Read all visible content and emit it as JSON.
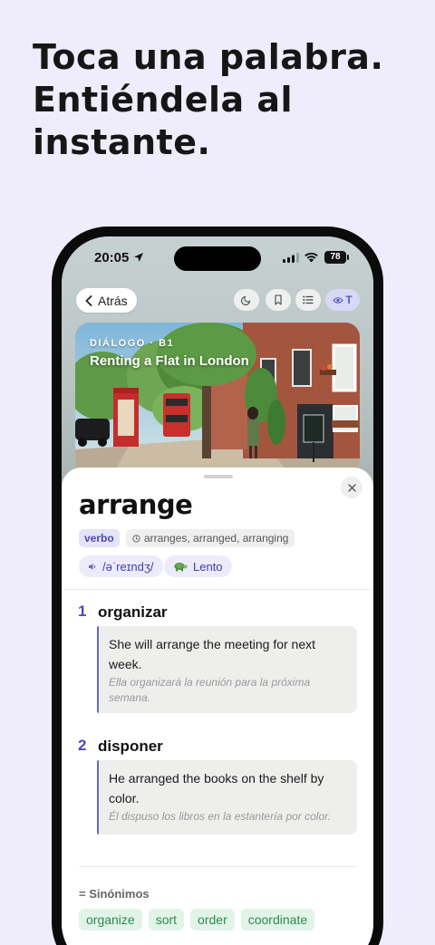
{
  "promo": {
    "line1": "Toca una palabra.",
    "line2": "Entiéndela al",
    "line3": "instante."
  },
  "status_bar": {
    "time": "20:05",
    "battery": "78"
  },
  "nav": {
    "back_label": "Atrás",
    "translate_toggle": "T"
  },
  "hero": {
    "kicker": "DIÁLOGO · B1",
    "title": "Renting a Flat in London"
  },
  "entry": {
    "word": "arrange",
    "part_of_speech": "verbo",
    "forms": "arranges, arranged, arranging",
    "pronunciation": "/əˈreɪndʒ/",
    "slow_label": "Lento"
  },
  "senses": [
    {
      "number": "1",
      "translation": "organizar",
      "example_en_1": "She will arrange the meeting for next",
      "example_en_2": "week.",
      "example_es_1": "Ella organizará la reunión para la próxima",
      "example_es_2": "semana."
    },
    {
      "number": "2",
      "translation": "disponer",
      "example_en_1": "He arranged the books on the shelf by",
      "example_en_2": "color.",
      "example_es_1": "Él dispuso los libros en la estantería por color."
    }
  ],
  "synonyms": {
    "title": "= Sinónimos",
    "items": [
      "organize",
      "sort",
      "order",
      "coordinate"
    ]
  },
  "colors": {
    "accent": "#4b49c0",
    "synonym_green": "#2b8a52",
    "background": "#efedfb"
  }
}
